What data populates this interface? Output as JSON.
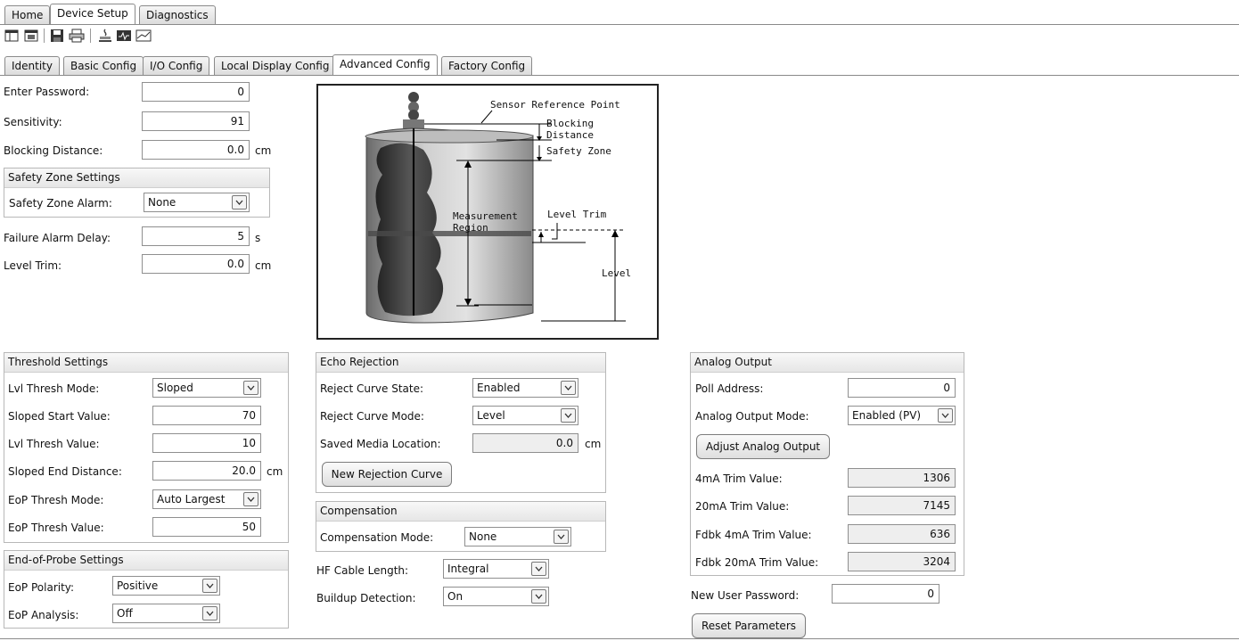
{
  "top_tabs": [
    "Home",
    "Device Setup",
    "Diagnostics"
  ],
  "sub_tabs": [
    "Identity",
    "Basic Config",
    "I/O Config",
    "Local Display Config",
    "Advanced Config",
    "Factory Config"
  ],
  "toolbar_icons": [
    "window-icon",
    "panel-icon",
    "save-icon",
    "print-icon",
    "connect-icon",
    "monitor-icon",
    "trend-icon"
  ],
  "fields": {
    "password": {
      "label": "Enter Password:",
      "value": "0"
    },
    "sensitivity": {
      "label": "Sensitivity:",
      "value": "91"
    },
    "blocking": {
      "label": "Blocking Distance:",
      "value": "0.0",
      "unit": "cm"
    },
    "safety_group": "Safety Zone Settings",
    "safety_alarm": {
      "label": "Safety Zone Alarm:",
      "value": "None"
    },
    "failure_delay": {
      "label": "Failure Alarm Delay:",
      "value": "5",
      "unit": "s"
    },
    "level_trim": {
      "label": "Level Trim:",
      "value": "0.0",
      "unit": "cm"
    }
  },
  "diagram": {
    "sensor_ref": "Sensor Reference Point",
    "blocking1": "Blocking",
    "blocking2": "Distance",
    "safety": "Safety Zone",
    "meas1": "Measurement",
    "meas2": "Region",
    "trim": "Level Trim",
    "level": "Level"
  },
  "threshold": {
    "title": "Threshold Settings",
    "mode": {
      "label": "Lvl Thresh Mode:",
      "value": "Sloped"
    },
    "start": {
      "label": "Sloped Start Value:",
      "value": "70"
    },
    "value": {
      "label": "Lvl Thresh Value:",
      "value": "10"
    },
    "end": {
      "label": "Sloped End Distance:",
      "value": "20.0",
      "unit": "cm"
    },
    "eop_mode": {
      "label": "EoP Thresh Mode:",
      "value": "Auto Largest"
    },
    "eop_value": {
      "label": "EoP Thresh Value:",
      "value": "50"
    }
  },
  "eop": {
    "title": "End-of-Probe Settings",
    "polarity": {
      "label": "EoP Polarity:",
      "value": "Positive"
    },
    "analysis": {
      "label": "EoP Analysis:",
      "value": "Off"
    }
  },
  "echo": {
    "title": "Echo Rejection",
    "state": {
      "label": "Reject Curve State:",
      "value": "Enabled"
    },
    "mode": {
      "label": "Reject Curve Mode:",
      "value": "Level"
    },
    "saved": {
      "label": "Saved Media Location:",
      "value": "0.0",
      "unit": "cm"
    },
    "button": "New Rejection Curve"
  },
  "compensation": {
    "title": "Compensation",
    "mode": {
      "label": "Compensation Mode:",
      "value": "None"
    }
  },
  "hf_cable": {
    "label": "HF Cable Length:",
    "value": "Integral"
  },
  "buildup": {
    "label": "Buildup Detection:",
    "value": "On"
  },
  "analog": {
    "title": "Analog Output",
    "poll": {
      "label": "Poll Address:",
      "value": "0"
    },
    "mode": {
      "label": "Analog Output Mode:",
      "value": "Enabled (PV)"
    },
    "adjust": "Adjust Analog Output",
    "trim4": {
      "label": "4mA Trim Value:",
      "value": "1306"
    },
    "trim20": {
      "label": "20mA Trim Value:",
      "value": "7145"
    },
    "fb4": {
      "label": "Fdbk 4mA Trim Value:",
      "value": "636"
    },
    "fb20": {
      "label": "Fdbk 20mA Trim Value:",
      "value": "3204"
    }
  },
  "new_password": {
    "label": "New User Password:",
    "value": "0"
  },
  "reset": "Reset Parameters"
}
